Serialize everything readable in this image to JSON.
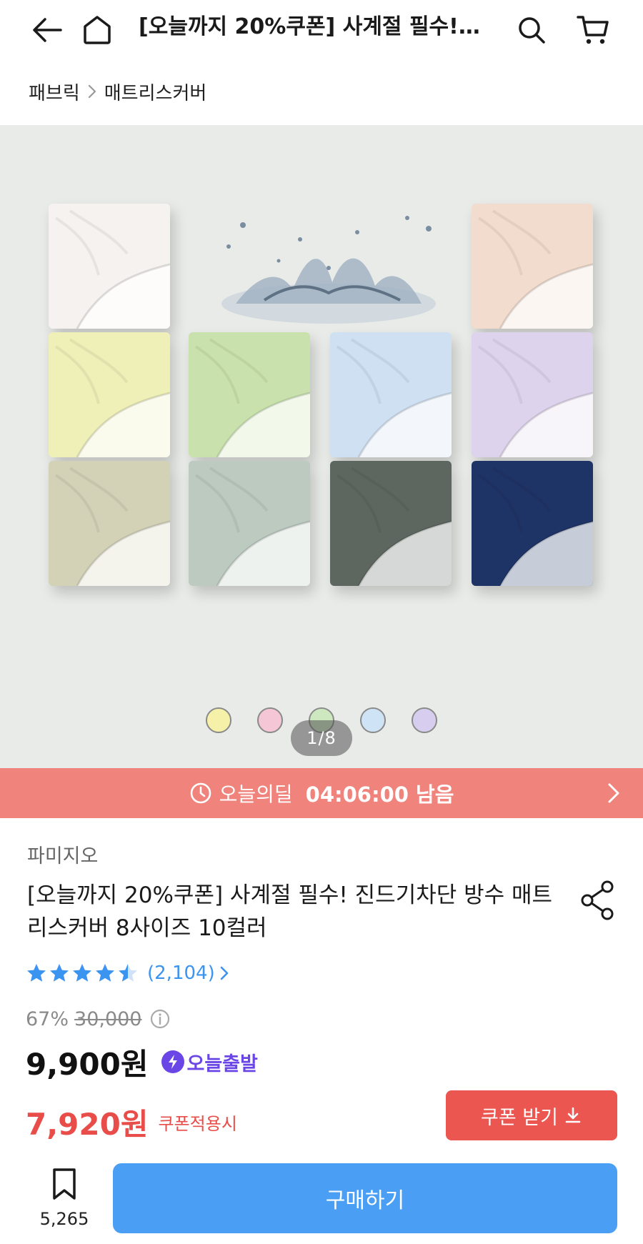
{
  "header": {
    "title": "[오늘까지 20%쿠폰] 사계절 필수!…",
    "back_icon": "back-arrow-icon",
    "home_icon": "home-icon",
    "search_icon": "search-icon",
    "cart_icon": "cart-icon"
  },
  "breadcrumb": {
    "items": [
      "패브릭",
      "매트리스커버"
    ]
  },
  "gallery": {
    "pager": "1/8",
    "sheet_colors": [
      "#f5f2ef",
      "#f2dccd",
      "#eef0b8",
      "#c9e2ad",
      "#cfe0f3",
      "#ddd3ec",
      "#d3d2b7",
      "#bccac0",
      "#5e6660",
      "#1f3466"
    ],
    "swatch_colors": [
      "#f6f1a8",
      "#f5c6d6",
      "#cde8bf",
      "#cfe3f6",
      "#d7cdee"
    ]
  },
  "deal": {
    "label": "오늘의딜",
    "time": "04:06:00 남음"
  },
  "product": {
    "brand": "파미지오",
    "title": "[오늘까지 20%쿠폰] 사계절 필수! 진드기차단 방수 매트리스커버 8사이즈 10컬러",
    "rating": 4.5,
    "review_count": "(2,104)",
    "discount_pct": "67%",
    "original_price": "30,000",
    "price": "9,900원",
    "shipping_badge": "오늘출발",
    "coupon_price": "7,920원",
    "coupon_note": "쿠폰적용시",
    "coupon_button": "쿠폰 받기"
  },
  "bottom": {
    "bookmark_count": "5,265",
    "buy_label": "구매하기"
  },
  "colors": {
    "accent_blue": "#4a9ff5",
    "deal_banner": "#f0837b",
    "coupon_red": "#e84d4a",
    "star_blue": "#3b94f0",
    "ship_purple": "#6b46e6"
  }
}
